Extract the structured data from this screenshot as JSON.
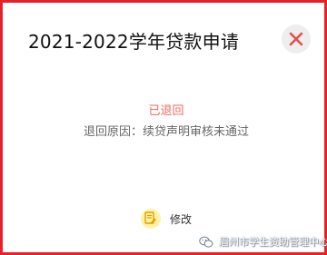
{
  "dialog": {
    "title": "2021-2022学年贷款申请",
    "close_icon": "close-icon",
    "status_text": "已退回",
    "reason_text": "退回原因：续贷声明审核未通过",
    "edit_label": "修改",
    "edit_icon": "edit-document-icon"
  },
  "watermark": {
    "text": "眉州市学生资助管理中心",
    "icon": "wechat-icon"
  },
  "colors": {
    "frame_border": "#e8202a",
    "close_icon": "#e5504a",
    "status": "#f26a5e",
    "edit_icon_bg": "#fff2a8"
  }
}
